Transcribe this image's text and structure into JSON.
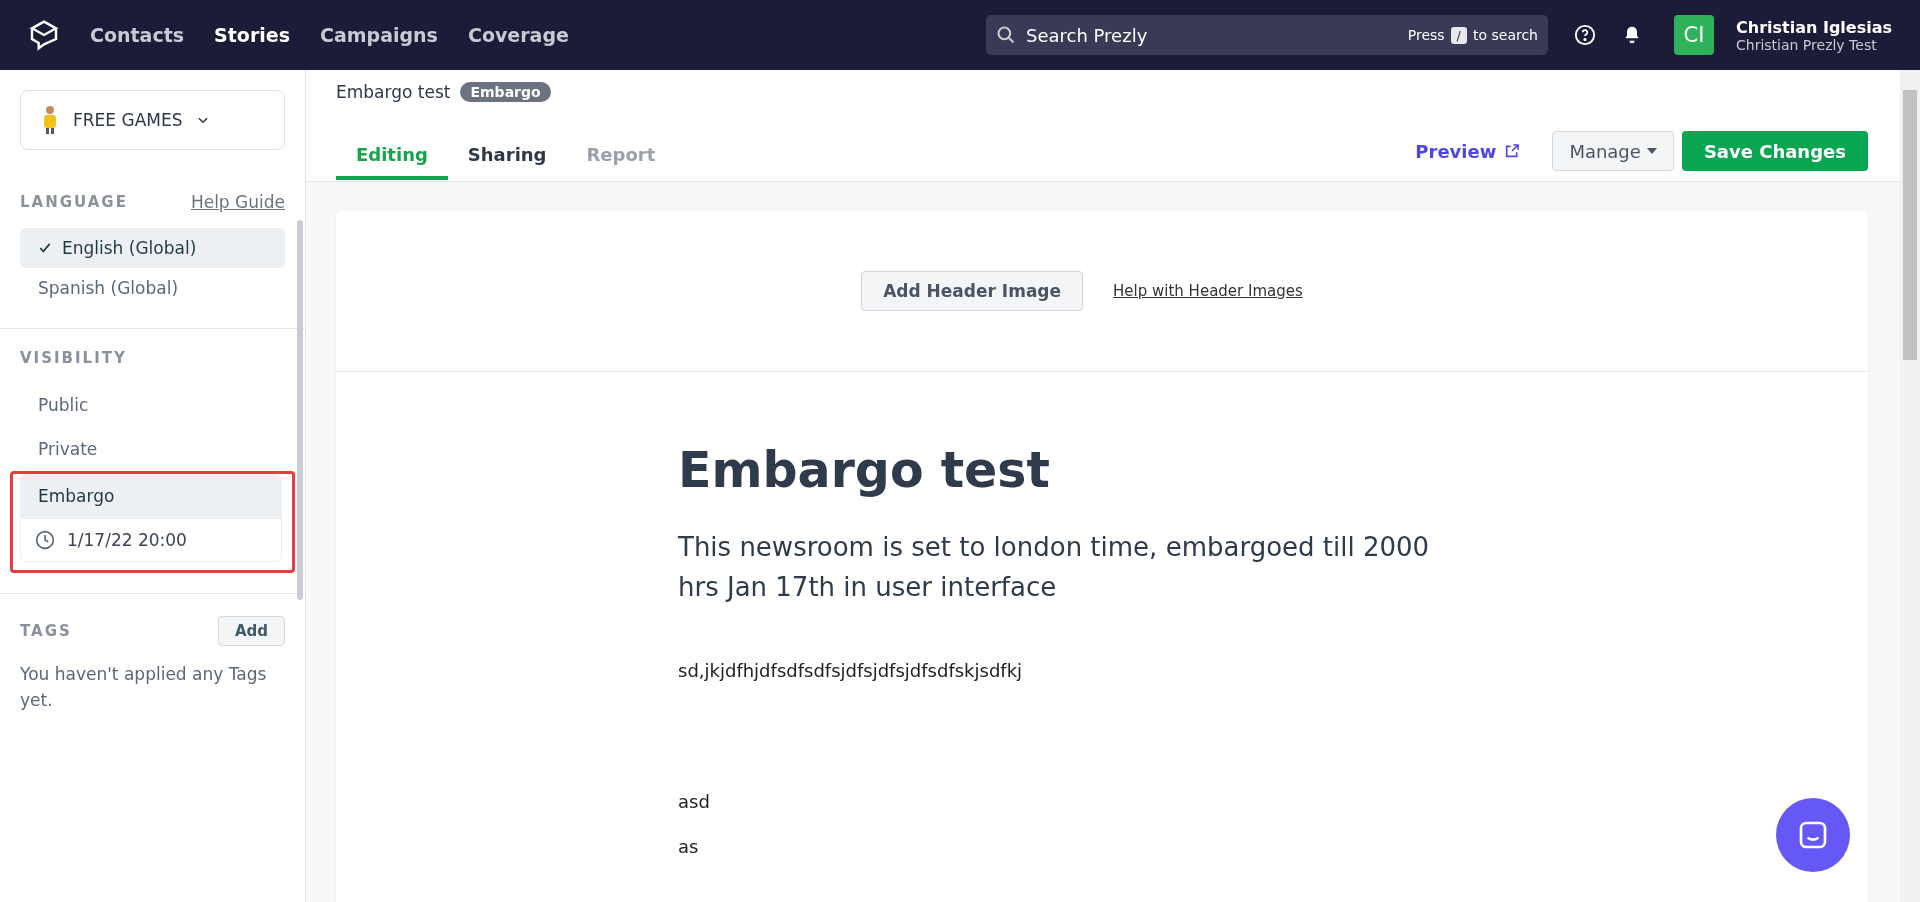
{
  "nav": {
    "items": [
      {
        "label": "Contacts",
        "selected": false
      },
      {
        "label": "Stories",
        "selected": true
      },
      {
        "label": "Campaigns",
        "selected": false
      },
      {
        "label": "Coverage",
        "selected": false
      }
    ],
    "search": {
      "placeholder": "Search Prezly",
      "hint_before": "Press",
      "key": "/",
      "hint_after": "to search"
    },
    "user": {
      "initials": "CI",
      "name": "Christian Iglesias",
      "org": "Christian Prezly Test"
    }
  },
  "sidebar": {
    "newsroom": "FREE GAMES",
    "language": {
      "title": "LANGUAGE",
      "help_link": "Help Guide",
      "items": [
        {
          "label": "English (Global)",
          "selected": true
        },
        {
          "label": "Spanish (Global)",
          "selected": false
        }
      ]
    },
    "visibility": {
      "title": "VISIBILITY",
      "items": [
        {
          "label": "Public",
          "selected": false
        },
        {
          "label": "Private",
          "selected": false
        },
        {
          "label": "Embargo",
          "selected": true
        }
      ],
      "embargo_date": "1/17/22 20:00"
    },
    "tags": {
      "title": "TAGS",
      "add_button": "Add",
      "empty_text": "You haven't applied any Tags yet."
    }
  },
  "story": {
    "title": "Embargo test",
    "badge": "Embargo",
    "tabs": [
      {
        "label": "Editing",
        "selected": true,
        "disabled": false
      },
      {
        "label": "Sharing",
        "selected": false,
        "disabled": false
      },
      {
        "label": "Report",
        "selected": false,
        "disabled": true
      }
    ],
    "preview": "Preview",
    "manage": "Manage",
    "save": "Save Changes"
  },
  "editor": {
    "add_header_button": "Add Header Image",
    "help_link": "Help with Header Images",
    "title": "Embargo test",
    "subtitle": "This newsroom is set to london time, embargoed till 2000 hrs Jan 17th in user interface",
    "paragraphs": [
      "sd,jkjdfhjdfsdfsdfsjdfsjdfsjdfsdfskjsdfkj",
      "asd",
      "as"
    ]
  }
}
